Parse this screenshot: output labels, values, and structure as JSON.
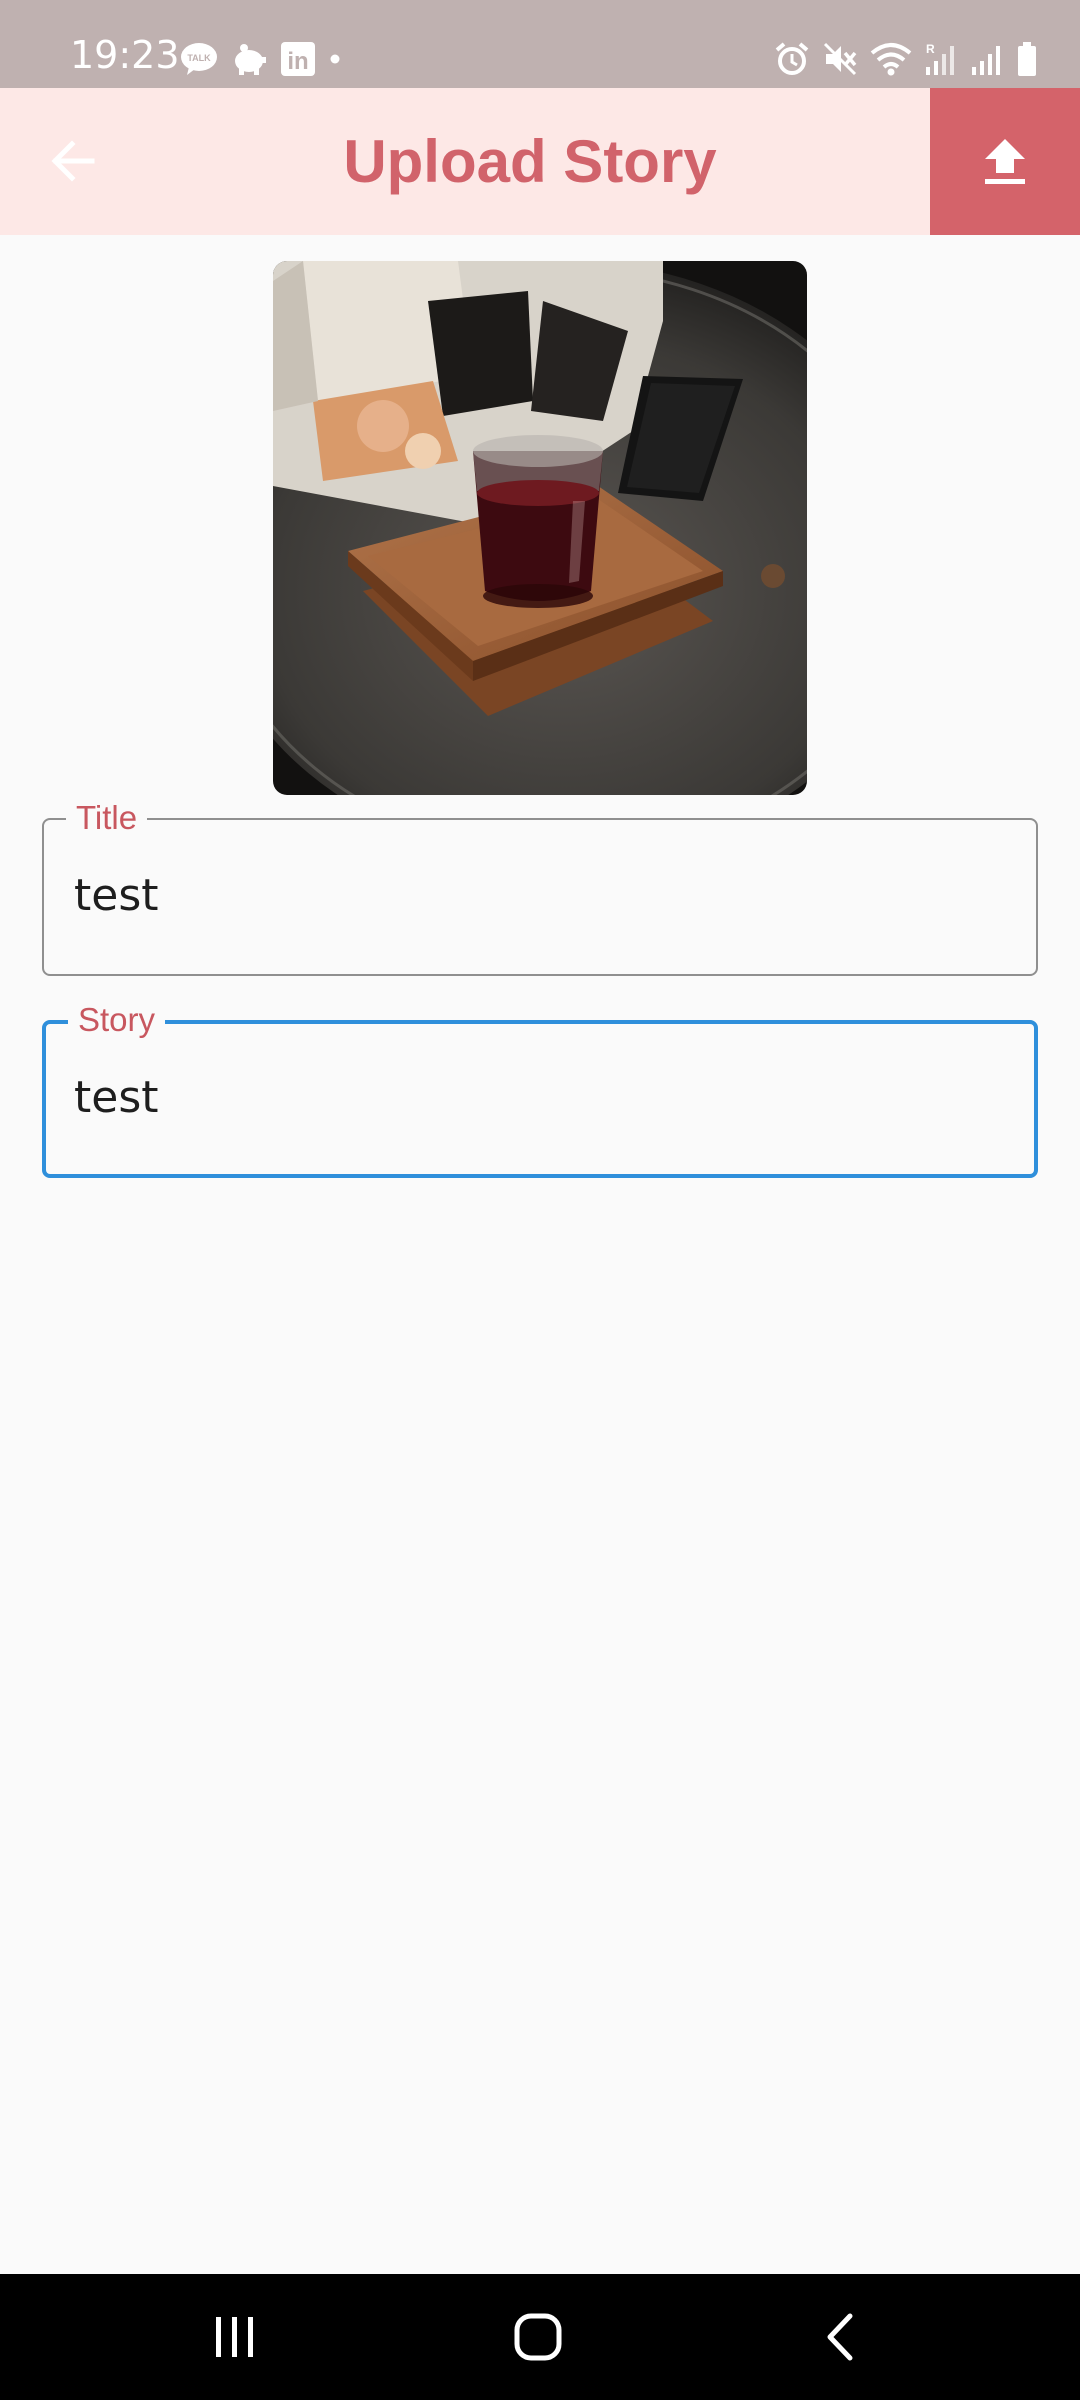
{
  "status_bar": {
    "time": "19:23",
    "left_icons": [
      "kakaotalk-icon",
      "piggy-bank-icon",
      "linkedin-icon",
      "dot-icon"
    ],
    "right_icons": [
      "alarm-icon",
      "mute-icon",
      "wifi-icon",
      "signal-roaming-icon",
      "signal-icon",
      "battery-icon"
    ],
    "talk_badge": "TALK",
    "linkedin_badge": "in",
    "roaming_badge": "R"
  },
  "app_bar": {
    "title": "Upload Story",
    "back_icon": "arrow-back-icon",
    "upload_icon": "upload-icon",
    "background": "#fde8e6",
    "accent": "#d4636a"
  },
  "form": {
    "title_field": {
      "label": "Title",
      "value": "test"
    },
    "story_field": {
      "label": "Story",
      "value": "test",
      "focused_color": "#2f8fdb"
    }
  },
  "nav_bar": {
    "items": [
      "recent-apps-icon",
      "home-icon",
      "back-icon"
    ]
  }
}
